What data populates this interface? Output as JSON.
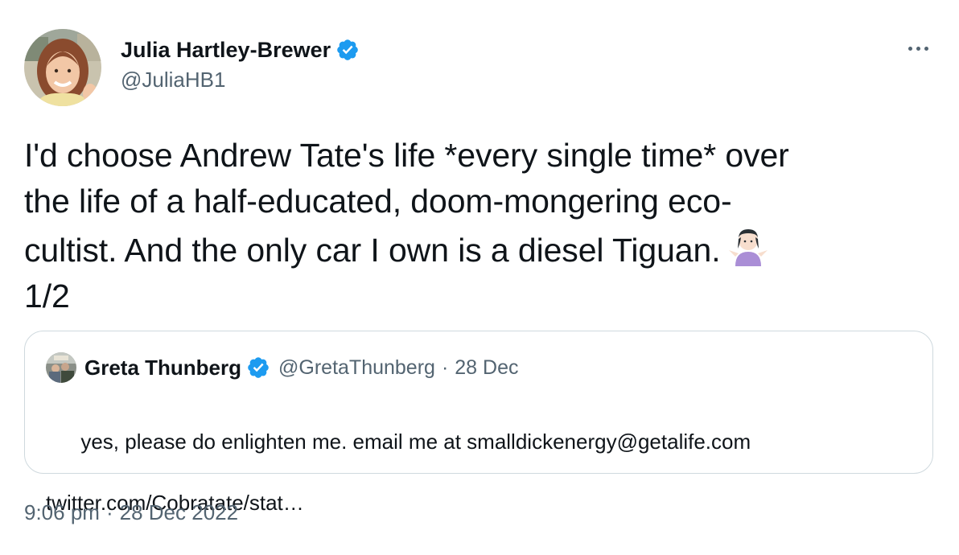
{
  "author": {
    "display_name": "Julia Hartley-Brewer",
    "handle": "@JuliaHB1",
    "verified": true,
    "avatar_icon": "profile-photo"
  },
  "tweet": {
    "text": "I'd choose Andrew Tate's life *every single time* over\nthe life of a half-educated, doom-mongering eco-\ncultist. And the only car I own is a diesel Tiguan.",
    "text_tail": "\n1/2",
    "emoji_icon": "person-shrugging-emoji"
  },
  "quoted_tweet": {
    "display_name": "Greta Thunberg",
    "handle": "@GretaThunberg",
    "separator": "·",
    "date": "28 Dec",
    "verified": true,
    "text": "yes, please do enlighten me. email me at smalldickenergy@getalife.com",
    "link": "twitter.com/Cobratate/stat…"
  },
  "meta": {
    "time": "9:06 pm",
    "separator": "·",
    "date": "28 Dec 2022"
  },
  "colors": {
    "text_primary": "#0f1419",
    "text_secondary": "#536471",
    "verified_blue": "#1d9bf0",
    "border": "#cfd9de"
  },
  "icons": {
    "more": "more-options-icon",
    "verified": "verified-badge-icon"
  }
}
